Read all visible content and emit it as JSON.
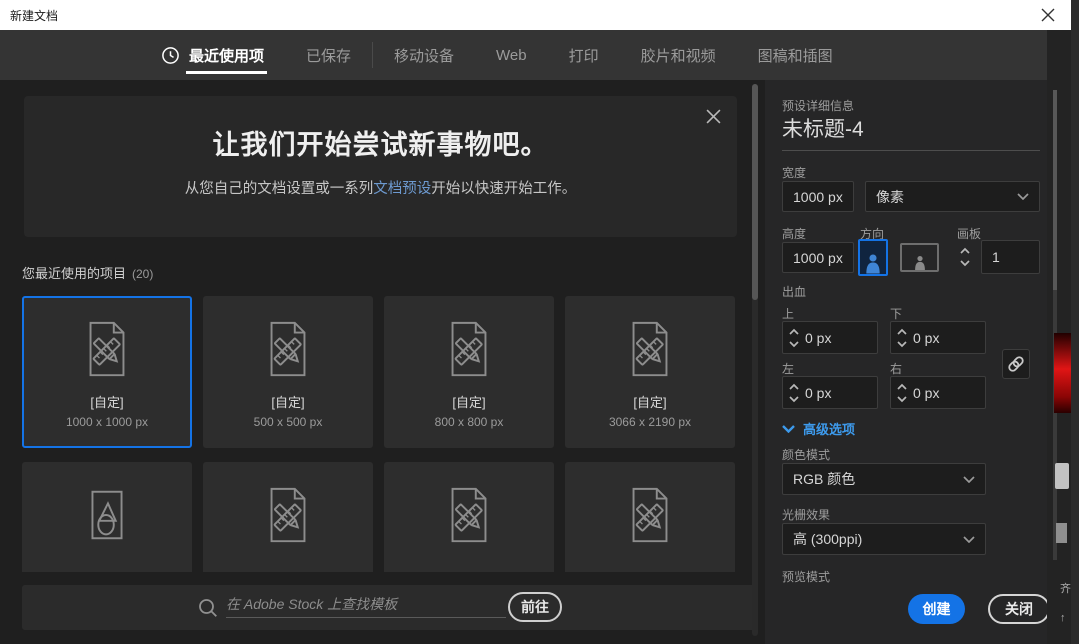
{
  "window": {
    "title": "新建文档"
  },
  "tabs": [
    {
      "label": "最近使用项"
    },
    {
      "label": "已保存"
    },
    {
      "label": "移动设备"
    },
    {
      "label": "Web"
    },
    {
      "label": "打印"
    },
    {
      "label": "胶片和视频"
    },
    {
      "label": "图稿和插图"
    }
  ],
  "banner": {
    "heading": "让我们开始尝试新事物吧。",
    "sub_before": "从您自己的文档设置或一系列",
    "link_text": "文档预设",
    "sub_after": "开始以快速开始工作。"
  },
  "recent": {
    "section_label": "您最近使用的项目",
    "section_count": "(20)",
    "cards": [
      {
        "name": "[自定]",
        "dims": "1000 x 1000 px",
        "selected": true
      },
      {
        "name": "[自定]",
        "dims": "500 x 500 px",
        "selected": false
      },
      {
        "name": "[自定]",
        "dims": "800 x 800 px",
        "selected": false
      },
      {
        "name": "[自定]",
        "dims": "3066 x 2190 px",
        "selected": false
      }
    ]
  },
  "search": {
    "placeholder": "在 Adobe Stock 上查找模板",
    "go_label": "前往"
  },
  "panel": {
    "header": "预设详细信息",
    "doc_title": "未标题-4",
    "width_label": "宽度",
    "width_value": "1000 px",
    "unit_value": "像素",
    "height_label": "高度",
    "height_value": "1000 px",
    "orientation_label": "方向",
    "artboards_label": "画板",
    "artboards_value": "1",
    "bleed_label": "出血",
    "bleed_top_label": "上",
    "bleed_top_value": "0 px",
    "bleed_bottom_label": "下",
    "bleed_bottom_value": "0 px",
    "bleed_left_label": "左",
    "bleed_left_value": "0 px",
    "bleed_right_label": "右",
    "bleed_right_value": "0 px",
    "advanced_label": "高级选项",
    "color_mode_label": "颜色模式",
    "color_mode_value": "RGB 颜色",
    "raster_label": "光栅效果",
    "raster_value": "高 (300ppi)",
    "preview_label": "预览模式",
    "create_label": "创建",
    "close_label": "关闭"
  },
  "background": {
    "partial_text_top": "齐",
    "partial_text_bottom": "↑"
  },
  "colors": {
    "accent_blue": "#1473e6",
    "link_blue": "#6d9ad0",
    "advanced_blue": "#3d9aec",
    "selected_card_border": "#1473e6",
    "swatch_red": "#e01515",
    "titlebar_white": "#ffffff",
    "tabbar_grey": "#343434",
    "panel_grey": "#262627"
  }
}
